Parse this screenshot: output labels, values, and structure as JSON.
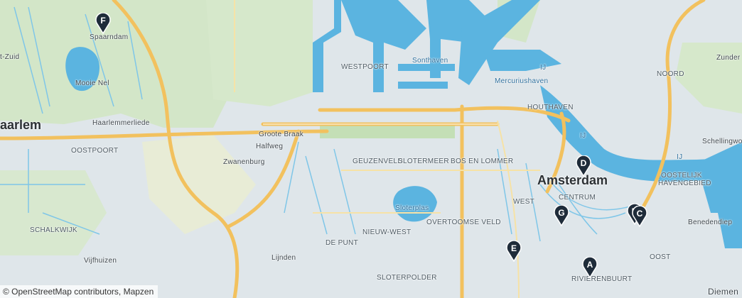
{
  "map": {
    "colors": {
      "water": "#5bb4e0",
      "land": "#dfe6ea",
      "green": "#cfe6c4",
      "motorway": "#f2c15e",
      "marker": "#1f2c3a"
    },
    "labels": {
      "amsterdam": "Amsterdam",
      "haarlem": "aarlem",
      "spaarndam": "Spaarndam",
      "mooie_nel": "Mooie Nel",
      "haarlemmerliede": "Haarlemmerliede",
      "oostpoort": "OOSTPOORT",
      "zwanenburg": "Zwanenburg",
      "halfweg": "Halfweg",
      "groote_braak": "Groote Braak",
      "westpoort": "WESTPOORT",
      "sonthaven": "Sonthaven",
      "mercuriushaven": "Mercuriushaven",
      "houthaven": "HOUTHAVEN",
      "noord": "NOORD",
      "zunderdorp": "Zunder",
      "schellingwoude": "Schellingwo",
      "geuzenveld": "GEUZENVELD",
      "slotermeer": "SLOTERMEER",
      "bos_en_lommer": "BOS EN LOMMER",
      "oostelijk_havengebied_1": "OOSTELIJK",
      "oostelijk_havengebied_2": "HAVENGEBIED",
      "centrum": "CENTRUM",
      "west": "WEST",
      "sloterplas": "Sloterplas",
      "overtoomse_veld": "OVERTOOMSE VELD",
      "nieuw_west": "NIEUW-WEST",
      "schalkwijk": "SCHALKWIJK",
      "de_punt": "DE PUNT",
      "vijfhuizen": "Vijfhuizen",
      "lijnden": "Lijnden",
      "slotervaart": "SLOTERPOLDER",
      "rivierenbuurt": "RIVIERENBUURT",
      "oost": "OOST",
      "benedendiep": "Benedendiep",
      "diemen": "Diemen",
      "t_zuid": "t-Zuid",
      "ij_1": "IJ",
      "ij_2": "IJ",
      "ij_3": "IJ"
    },
    "markers": [
      {
        "id": "A",
        "label": "A"
      },
      {
        "id": "B",
        "label": "B"
      },
      {
        "id": "C",
        "label": "C"
      },
      {
        "id": "D",
        "label": "D"
      },
      {
        "id": "E",
        "label": "E"
      },
      {
        "id": "F",
        "label": "F"
      },
      {
        "id": "G",
        "label": "G"
      }
    ],
    "attribution": "© OpenStreetMap contributors, Mapzen"
  }
}
